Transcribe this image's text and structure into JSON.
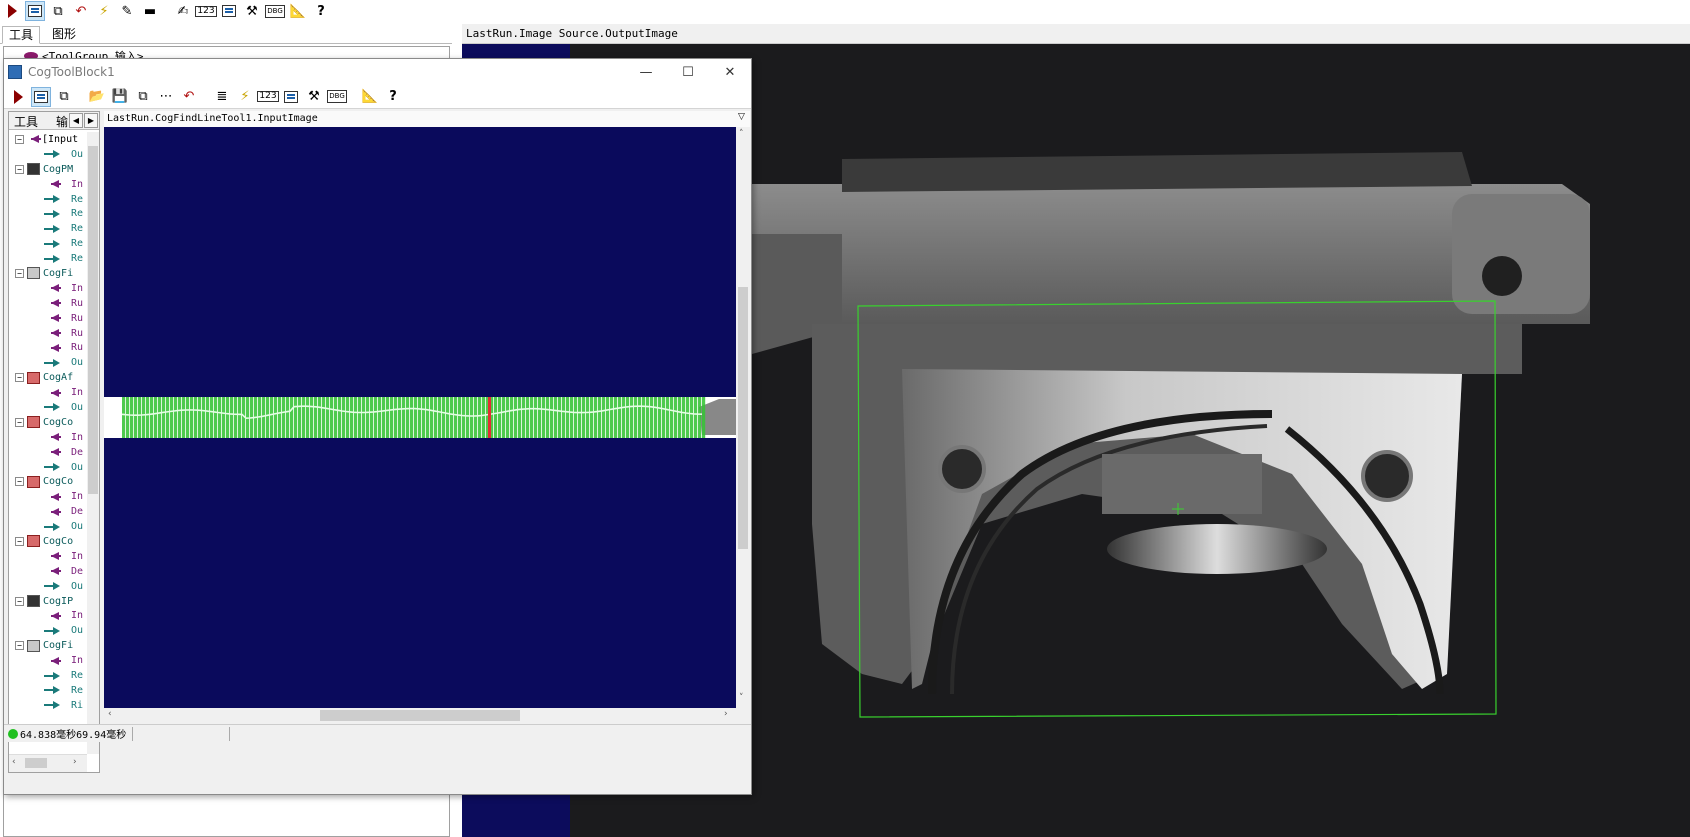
{
  "main_toolbar": {
    "buttons": [
      "run",
      "show-results",
      "show-multiple",
      "reset",
      "live",
      "edit",
      "flag",
      "notes",
      "values",
      "terminals",
      "tools",
      "debug",
      "measure",
      "help"
    ]
  },
  "left_panel": {
    "tabs": [
      "工具",
      "图形"
    ],
    "tree_root": "<ToolGroup 输入>"
  },
  "right_view": {
    "header": "LastRun.Image Source.OutputImage",
    "roi_color": "#39d12e"
  },
  "sub_window": {
    "title": "CogToolBlock1",
    "controls": {
      "minimize": "—",
      "maximize": "☐",
      "close": "✕"
    },
    "tree_tabs": {
      "tools": "工具",
      "input": "输"
    },
    "tree_items": [
      {
        "kind": "input-group",
        "label": "[Input"
      },
      {
        "kind": "out",
        "label": "Ou"
      },
      {
        "kind": "tool",
        "label": "CogPM",
        "icon": "dark"
      },
      {
        "kind": "in",
        "label": "In"
      },
      {
        "kind": "out",
        "label": "Re"
      },
      {
        "kind": "out",
        "label": "Re"
      },
      {
        "kind": "out",
        "label": "Re"
      },
      {
        "kind": "out",
        "label": "Re"
      },
      {
        "kind": "out",
        "label": "Re"
      },
      {
        "kind": "tool",
        "label": "CogFi",
        "icon": "gray"
      },
      {
        "kind": "in",
        "label": "In"
      },
      {
        "kind": "in",
        "label": "Ru"
      },
      {
        "kind": "in",
        "label": "Ru"
      },
      {
        "kind": "in",
        "label": "Ru"
      },
      {
        "kind": "in",
        "label": "Ru"
      },
      {
        "kind": "out",
        "label": "Ou"
      },
      {
        "kind": "tool",
        "label": "CogAf",
        "icon": "red"
      },
      {
        "kind": "in",
        "label": "In"
      },
      {
        "kind": "out",
        "label": "Ou"
      },
      {
        "kind": "tool",
        "label": "CogCo",
        "icon": "red"
      },
      {
        "kind": "in",
        "label": "In"
      },
      {
        "kind": "in",
        "label": "De"
      },
      {
        "kind": "out",
        "label": "Ou"
      },
      {
        "kind": "tool",
        "label": "CogCo",
        "icon": "red"
      },
      {
        "kind": "in",
        "label": "In"
      },
      {
        "kind": "in",
        "label": "De"
      },
      {
        "kind": "out",
        "label": "Ou"
      },
      {
        "kind": "tool",
        "label": "CogCo",
        "icon": "red"
      },
      {
        "kind": "in",
        "label": "In"
      },
      {
        "kind": "in",
        "label": "De"
      },
      {
        "kind": "out",
        "label": "Ou"
      },
      {
        "kind": "tool",
        "label": "CogIP",
        "icon": "dark"
      },
      {
        "kind": "in",
        "label": "In"
      },
      {
        "kind": "out",
        "label": "Ou"
      },
      {
        "kind": "tool",
        "label": "CogFi",
        "icon": "gray"
      },
      {
        "kind": "in",
        "label": "In"
      },
      {
        "kind": "out",
        "label": "Re"
      },
      {
        "kind": "out",
        "label": "Re"
      },
      {
        "kind": "out",
        "label": "Ri"
      }
    ],
    "display_header": "LastRun.CogFindLineTool1.InputImage",
    "status": {
      "text": "64.838毫秒69.94毫秒",
      "color": "#20c020"
    },
    "display_colors": {
      "background": "#0a0a5c",
      "caliper": "#35c335",
      "edge": "#e4ffe4",
      "marker": "#e03030"
    }
  }
}
